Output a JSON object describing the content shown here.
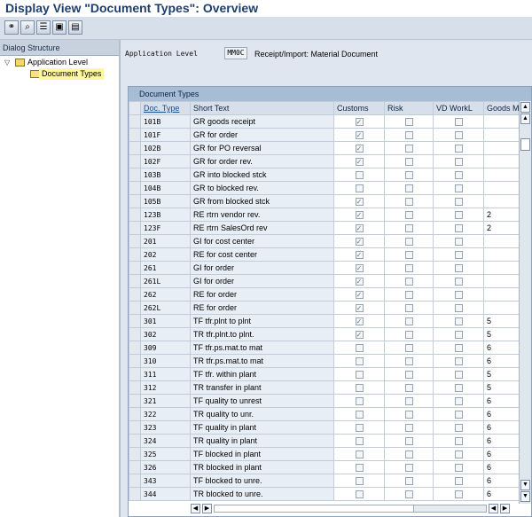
{
  "title": "Display View \"Document Types\": Overview",
  "toolbar": {
    "buttons": [
      {
        "icon": "glasses-icon",
        "glyph": "⚭"
      },
      {
        "icon": "magnifier-icon",
        "glyph": "⌕"
      },
      {
        "icon": "list-icon",
        "glyph": "☰"
      },
      {
        "icon": "save-icon",
        "glyph": "▣"
      },
      {
        "icon": "document-icon",
        "glyph": "▤"
      }
    ]
  },
  "tree": {
    "header": "Dialog Structure",
    "items": [
      {
        "label": "Application Level",
        "toggle": "▽",
        "folder": "closed"
      },
      {
        "label": "Document Types",
        "folder": "open",
        "selected": true
      }
    ]
  },
  "app_level": {
    "label": "Application Level",
    "value": "MM0C",
    "description": "Receipt/Import: Material Document"
  },
  "table": {
    "caption": "Document Types",
    "columns": [
      "Doc. Type",
      "Short Text",
      "Customs",
      "Risk",
      "VD WorkL",
      "Goods Mvt"
    ],
    "rows": [
      {
        "doc": "101B",
        "text": "GR goods receipt",
        "customs": true,
        "risk": false,
        "vd": false,
        "gm": ""
      },
      {
        "doc": "101F",
        "text": "GR for order",
        "customs": true,
        "risk": false,
        "vd": false,
        "gm": ""
      },
      {
        "doc": "102B",
        "text": "GR for PO   reversal",
        "customs": true,
        "risk": false,
        "vd": false,
        "gm": ""
      },
      {
        "doc": "102F",
        "text": "GR for order   rev.",
        "customs": true,
        "risk": false,
        "vd": false,
        "gm": ""
      },
      {
        "doc": "103B",
        "text": "GR into blocked stck",
        "customs": false,
        "risk": false,
        "vd": false,
        "gm": ""
      },
      {
        "doc": "104B",
        "text": "GR to blocked   rev.",
        "customs": false,
        "risk": false,
        "vd": false,
        "gm": ""
      },
      {
        "doc": "105B",
        "text": "GR from blocked stck",
        "customs": true,
        "risk": false,
        "vd": false,
        "gm": ""
      },
      {
        "doc": "123B",
        "text": "RE rtrn vendor rev.",
        "customs": true,
        "risk": false,
        "vd": false,
        "gm": "2"
      },
      {
        "doc": "123F",
        "text": "RE rtrn SalesOrd rev",
        "customs": true,
        "risk": false,
        "vd": false,
        "gm": "2"
      },
      {
        "doc": "201",
        "text": "GI for cost center",
        "customs": true,
        "risk": false,
        "vd": false,
        "gm": ""
      },
      {
        "doc": "202",
        "text": "RE for cost center",
        "customs": true,
        "risk": false,
        "vd": false,
        "gm": ""
      },
      {
        "doc": "261",
        "text": "GI for order",
        "customs": true,
        "risk": false,
        "vd": false,
        "gm": ""
      },
      {
        "doc": "261L",
        "text": "GI for order",
        "customs": true,
        "risk": false,
        "vd": false,
        "gm": ""
      },
      {
        "doc": "262",
        "text": "RE for order",
        "customs": true,
        "risk": false,
        "vd": false,
        "gm": ""
      },
      {
        "doc": "262L",
        "text": "RE for order",
        "customs": true,
        "risk": false,
        "vd": false,
        "gm": ""
      },
      {
        "doc": "301",
        "text": "TF tfr.plnt to plnt",
        "customs": true,
        "risk": false,
        "vd": false,
        "gm": "5"
      },
      {
        "doc": "302",
        "text": "TR tfr.plnt.to plnt.",
        "customs": true,
        "risk": false,
        "vd": false,
        "gm": "5"
      },
      {
        "doc": "309",
        "text": "TF tfr.ps.mat.to mat",
        "customs": false,
        "risk": false,
        "vd": false,
        "gm": "6"
      },
      {
        "doc": "310",
        "text": "TR tfr.ps.mat.to mat",
        "customs": false,
        "risk": false,
        "vd": false,
        "gm": "6"
      },
      {
        "doc": "311",
        "text": "TF tfr. within plant",
        "customs": false,
        "risk": false,
        "vd": false,
        "gm": "5"
      },
      {
        "doc": "312",
        "text": "TR transfer in plant",
        "customs": false,
        "risk": false,
        "vd": false,
        "gm": "5"
      },
      {
        "doc": "321",
        "text": "TF quality to unrest",
        "customs": false,
        "risk": false,
        "vd": false,
        "gm": "6"
      },
      {
        "doc": "322",
        "text": "TR quality to unr.",
        "customs": false,
        "risk": false,
        "vd": false,
        "gm": "6"
      },
      {
        "doc": "323",
        "text": "TF quality in plant",
        "customs": false,
        "risk": false,
        "vd": false,
        "gm": "6"
      },
      {
        "doc": "324",
        "text": "TR quality in plant",
        "customs": false,
        "risk": false,
        "vd": false,
        "gm": "6"
      },
      {
        "doc": "325",
        "text": "TF blocked in plant",
        "customs": false,
        "risk": false,
        "vd": false,
        "gm": "6"
      },
      {
        "doc": "326",
        "text": "TR blocked in plant",
        "customs": false,
        "risk": false,
        "vd": false,
        "gm": "6"
      },
      {
        "doc": "343",
        "text": "TF blocked to unre.",
        "customs": false,
        "risk": false,
        "vd": false,
        "gm": "6"
      },
      {
        "doc": "344",
        "text": "TR blocked to unre.",
        "customs": false,
        "risk": false,
        "vd": false,
        "gm": "6"
      }
    ]
  },
  "colors": {
    "title": "#1d3e6e",
    "caption": "#a7bdd5",
    "header": "#d7e0ea"
  }
}
